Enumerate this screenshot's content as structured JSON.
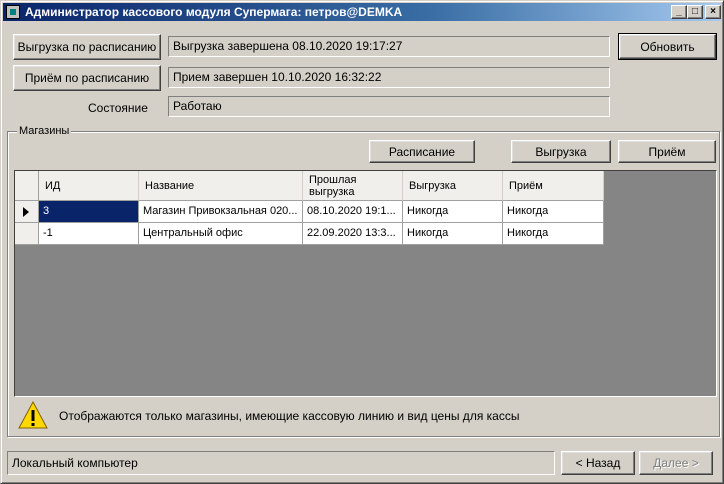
{
  "window": {
    "title": "Администратор кассового модуля Супермага: петров@DEMKA",
    "minimize": "_",
    "maximize": "□",
    "close": "×"
  },
  "top": {
    "unload_schedule_button": "Выгрузка по расписанию",
    "unload_status": "Выгрузка завершена 08.10.2020 19:17:27",
    "receive_schedule_button": "Приём по расписанию",
    "receive_status": "Прием завершен 10.10.2020 16:32:22",
    "state_label": "Состояние",
    "state_value": "Работаю",
    "refresh_button": "Обновить"
  },
  "stores": {
    "group_label": "Магазины",
    "schedule_button": "Расписание",
    "unload_button": "Выгрузка",
    "receive_button": "Приём",
    "columns": [
      "ИД",
      "Название",
      "Прошлая выгрузка",
      "Выгрузка",
      "Приём"
    ],
    "rows": [
      {
        "id": "3",
        "name": "Магазин Привокзальная 020...",
        "last_unload": "08.10.2020 19:1...",
        "unload": "Никогда",
        "receive": "Никогда"
      },
      {
        "id": "-1",
        "name": "Центральный офис",
        "last_unload": "22.09.2020 13:3...",
        "unload": "Никогда",
        "receive": "Никогда"
      }
    ],
    "warning": "Отображаются только магазины, имеющие кассовую линию и вид цены для кассы"
  },
  "footer": {
    "location": "Локальный компьютер",
    "back_button": "< Назад",
    "next_button": "Далее >"
  },
  "icons": {
    "warning": "warning-icon",
    "row_pointer": "row-pointer-icon"
  },
  "colors": {
    "titlebar_start": "#0a246a",
    "selection": "#0a246a",
    "grid_background": "#858585",
    "window_face": "#d4d0c8"
  }
}
